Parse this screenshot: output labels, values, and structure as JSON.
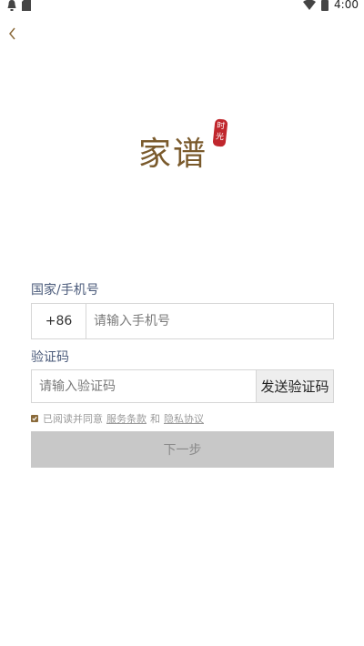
{
  "status_bar": {
    "time": "4:00",
    "icons": [
      "notification-icon",
      "sd-card-icon",
      "wifi-icon",
      "battery-icon"
    ]
  },
  "header": {
    "back_icon": "chevron-left-icon"
  },
  "logo": {
    "text": "家谱",
    "seal_text": "时光"
  },
  "form": {
    "phone_label": "国家/手机号",
    "country_code": "+86",
    "phone_placeholder": "请输入手机号",
    "code_label": "验证码",
    "code_placeholder": "请输入验证码",
    "send_code_label": "发送验证码",
    "agree_prefix": "已阅读并同意",
    "terms_link": "服务条款",
    "and_text": "和",
    "privacy_link": "隐私协议",
    "agree_checked": true,
    "next_label": "下一步"
  },
  "colors": {
    "accent_brown": "#7a5a2c",
    "seal_red": "#c0272d",
    "label_blue": "#4a5a7a",
    "button_disabled": "#c8c8c8"
  }
}
